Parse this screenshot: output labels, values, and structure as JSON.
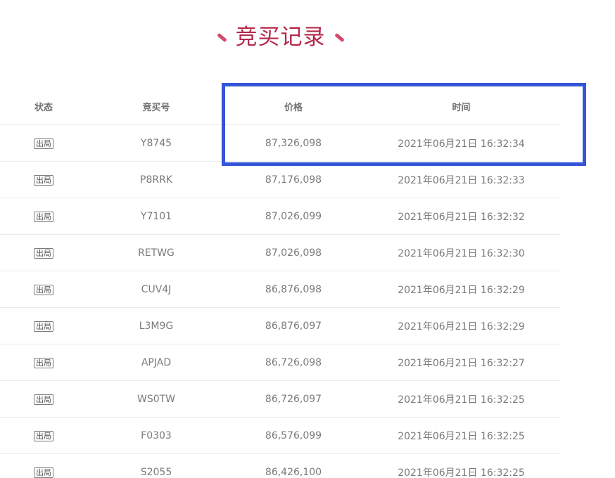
{
  "page": {
    "title": "竞买记录"
  },
  "table": {
    "headers": {
      "status": "状态",
      "bid_no": "竞买号",
      "price": "价格",
      "time": "时间"
    },
    "rows": [
      {
        "status": "出局",
        "bid_no": "Y8745",
        "price": "87,326,098",
        "time": "2021年06月21日 16:32:34"
      },
      {
        "status": "出局",
        "bid_no": "P8RRK",
        "price": "87,176,098",
        "time": "2021年06月21日 16:32:33"
      },
      {
        "status": "出局",
        "bid_no": "Y7101",
        "price": "87,026,099",
        "time": "2021年06月21日 16:32:32"
      },
      {
        "status": "出局",
        "bid_no": "RETWG",
        "price": "87,026,098",
        "time": "2021年06月21日 16:32:30"
      },
      {
        "status": "出局",
        "bid_no": "CUV4J",
        "price": "86,876,098",
        "time": "2021年06月21日 16:32:29"
      },
      {
        "status": "出局",
        "bid_no": "L3M9G",
        "price": "86,876,097",
        "time": "2021年06月21日 16:32:29"
      },
      {
        "status": "出局",
        "bid_no": "APJAD",
        "price": "86,726,098",
        "time": "2021年06月21日 16:32:27"
      },
      {
        "status": "出局",
        "bid_no": "WS0TW",
        "price": "86,726,097",
        "time": "2021年06月21日 16:32:25"
      },
      {
        "status": "出局",
        "bid_no": "F0303",
        "price": "86,576,099",
        "time": "2021年06月21日 16:32:25"
      },
      {
        "status": "出局",
        "bid_no": "S2055",
        "price": "86,426,100",
        "time": "2021年06月21日 16:32:25"
      }
    ]
  },
  "colors": {
    "title": "#b5284a",
    "highlight": "#3355d8",
    "text": "#7a7a7a"
  }
}
